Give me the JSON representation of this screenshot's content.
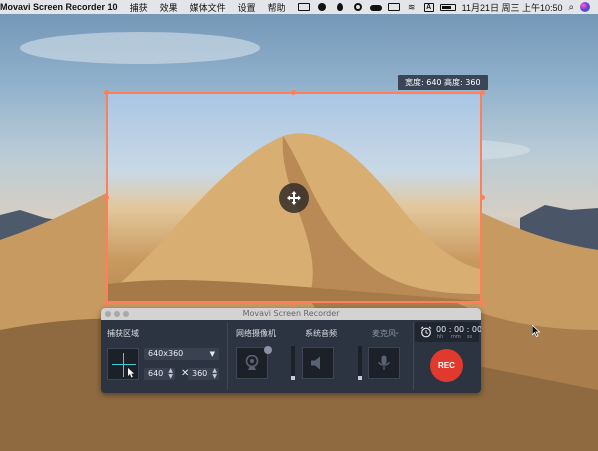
{
  "menubar": {
    "app_name": "Movavi Screen Recorder 10",
    "menus": [
      "捕获",
      "效果",
      "媒体文件",
      "设置",
      "帮助"
    ],
    "clock": "11月21日 周三 上午10:50",
    "keyboard_icon_letter": "A",
    "tray_icons": [
      "screen-icon",
      "shield-icon",
      "drop-icon",
      "ring-icon",
      "cloud-icon",
      "display-icon",
      "wifi-icon",
      "keyboard-input-icon",
      "battery-icon"
    ]
  },
  "capture_region": {
    "size_badge": "宽度: 640  高度: 360"
  },
  "recorder": {
    "window_title": "Movavi Screen Recorder",
    "capture_area_label": "捕获区域",
    "preset_value": "640x360",
    "width_value": "640",
    "height_value": "360",
    "times_symbol": "✕",
    "webcam_label": "网络摄像机",
    "system_audio_label": "系统音频",
    "microphone_label": "麦克风",
    "timer": "00 : 00 : 00",
    "timer_units": {
      "h": "hh",
      "m": "mm",
      "s": "ss"
    },
    "rec_label": "REC"
  },
  "colors": {
    "selection_border": "#ff7f5a",
    "panel_bg": "#2c3341",
    "rec_button": "#e03a2e",
    "crosshair": "#3bd0d7"
  }
}
